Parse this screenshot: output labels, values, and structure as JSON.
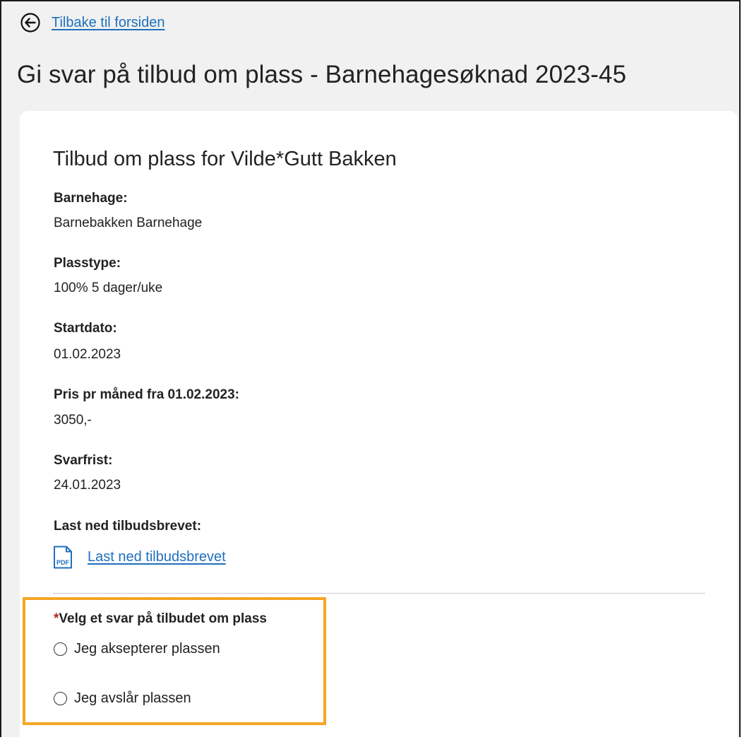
{
  "nav": {
    "back_label": "Tilbake til forsiden",
    "back_icon": "arrow-left-circle-icon"
  },
  "page": {
    "title": "Gi svar på tilbud om plass - Barnehagesøknad 2023-45"
  },
  "offer": {
    "title": "Tilbud om plass for Vilde*Gutt Bakken",
    "fields": [
      {
        "label": "Barnehage:",
        "value": "Barnebakken Barnehage"
      },
      {
        "label": "Plasstype:",
        "value": "100% 5 dager/uke"
      },
      {
        "label": "Startdato:",
        "value": "01.02.2023"
      },
      {
        "label": "Pris pr måned fra 01.02.2023:",
        "value": "3050,-"
      },
      {
        "label": "Svarfrist:",
        "value": "24.01.2023"
      }
    ],
    "download": {
      "label": "Last ned tilbudsbrevet:",
      "link_text": "Last ned tilbudsbrevet",
      "icon": "pdf-file-icon",
      "icon_text": "PDF"
    }
  },
  "response": {
    "required_marker": "*",
    "question": "Velg et svar på tilbudet om plass",
    "options": [
      {
        "label": "Jeg aksepterer plassen",
        "selected": false
      },
      {
        "label": "Jeg avslår plassen",
        "selected": false
      }
    ]
  },
  "colors": {
    "link": "#1f6fbf",
    "highlight_border": "#f5a623",
    "page_background": "#f1f1f1",
    "card_background": "#ffffff",
    "required": "#b3261e"
  }
}
